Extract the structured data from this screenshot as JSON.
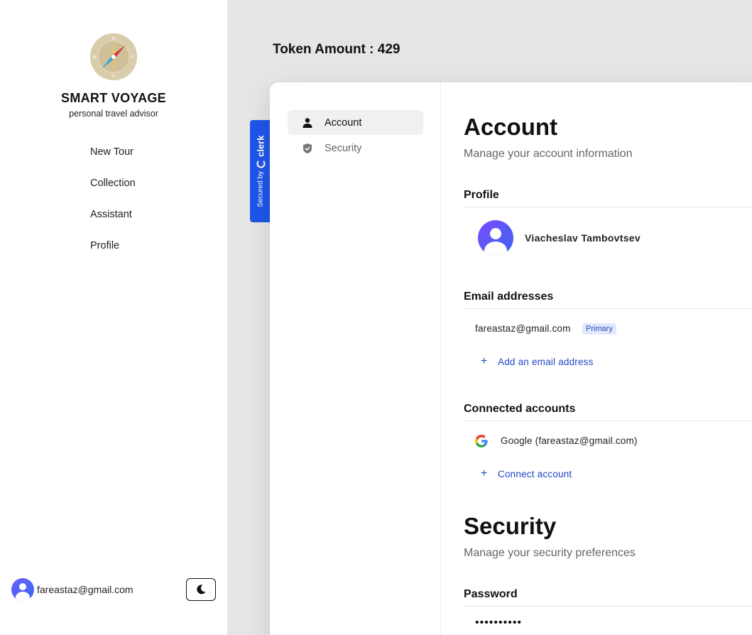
{
  "sidebar": {
    "brand_title": "SMART VOYAGE",
    "brand_subtitle": "personal travel advisor",
    "nav": [
      "New Tour",
      "Collection",
      "Assistant",
      "Profile"
    ],
    "user_email": "fareastaz@gmail.com"
  },
  "header": {
    "token_label": "Token Amount : 429"
  },
  "clerk": {
    "secured_by": "Secured by",
    "brand": "clerk"
  },
  "account_nav": {
    "items": [
      {
        "label": "Account",
        "icon": "user-icon",
        "active": true
      },
      {
        "label": "Security",
        "icon": "shield-icon",
        "active": false
      }
    ]
  },
  "account": {
    "title": "Account",
    "subtitle": "Manage your account information",
    "profile": {
      "section_title": "Profile",
      "name": "Viacheslav Tambovtsev"
    },
    "email": {
      "section_title": "Email addresses",
      "address": "fareastaz@gmail.com",
      "badge": "Primary",
      "add_label": "Add an email address"
    },
    "connected": {
      "section_title": "Connected accounts",
      "google": "Google (fareastaz@gmail.com)",
      "connect_label": "Connect account"
    }
  },
  "security": {
    "title": "Security",
    "subtitle": "Manage your security preferences",
    "password_title": "Password",
    "password_masked": "••••••••••"
  },
  "colors": {
    "accent": "#1f55e8",
    "link": "#2146c4",
    "badge_bg": "#e0e8fb"
  }
}
